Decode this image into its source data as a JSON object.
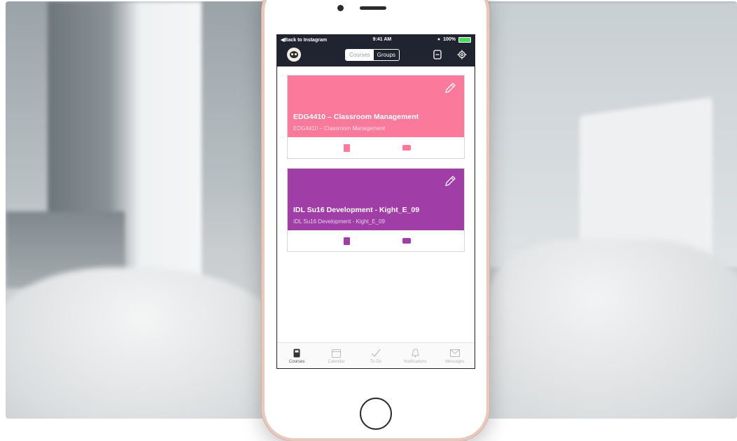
{
  "status_bar": {
    "back_label": "◀Back to Instagram",
    "time": "9:41 AM",
    "battery": "100%"
  },
  "nav": {
    "segments": [
      "Courses",
      "Groups"
    ],
    "selected_segment": "Courses"
  },
  "courses": [
    {
      "title": "EDG4410 – Classroom Management",
      "subtitle": "EDG4410 – Classroom Management",
      "color": "#fb7a9b"
    },
    {
      "title": "IDL Su16 Development - Kight_E_09",
      "subtitle": "IDL Su16 Development - Kight_E_09",
      "color": "#a03da7"
    }
  ],
  "tabs": [
    {
      "label": "Courses",
      "icon": "course-book-icon",
      "active": true
    },
    {
      "label": "Calendar",
      "icon": "calendar-icon",
      "active": false
    },
    {
      "label": "To Do",
      "icon": "checkmark-icon",
      "active": false
    },
    {
      "label": "Notifications",
      "icon": "bell-icon",
      "active": false
    },
    {
      "label": "Messages",
      "icon": "envelope-icon",
      "active": false
    }
  ],
  "colors": {
    "nav_bg": "#1f2430",
    "course_1": "#fb7a9b",
    "course_2": "#a03da7"
  }
}
